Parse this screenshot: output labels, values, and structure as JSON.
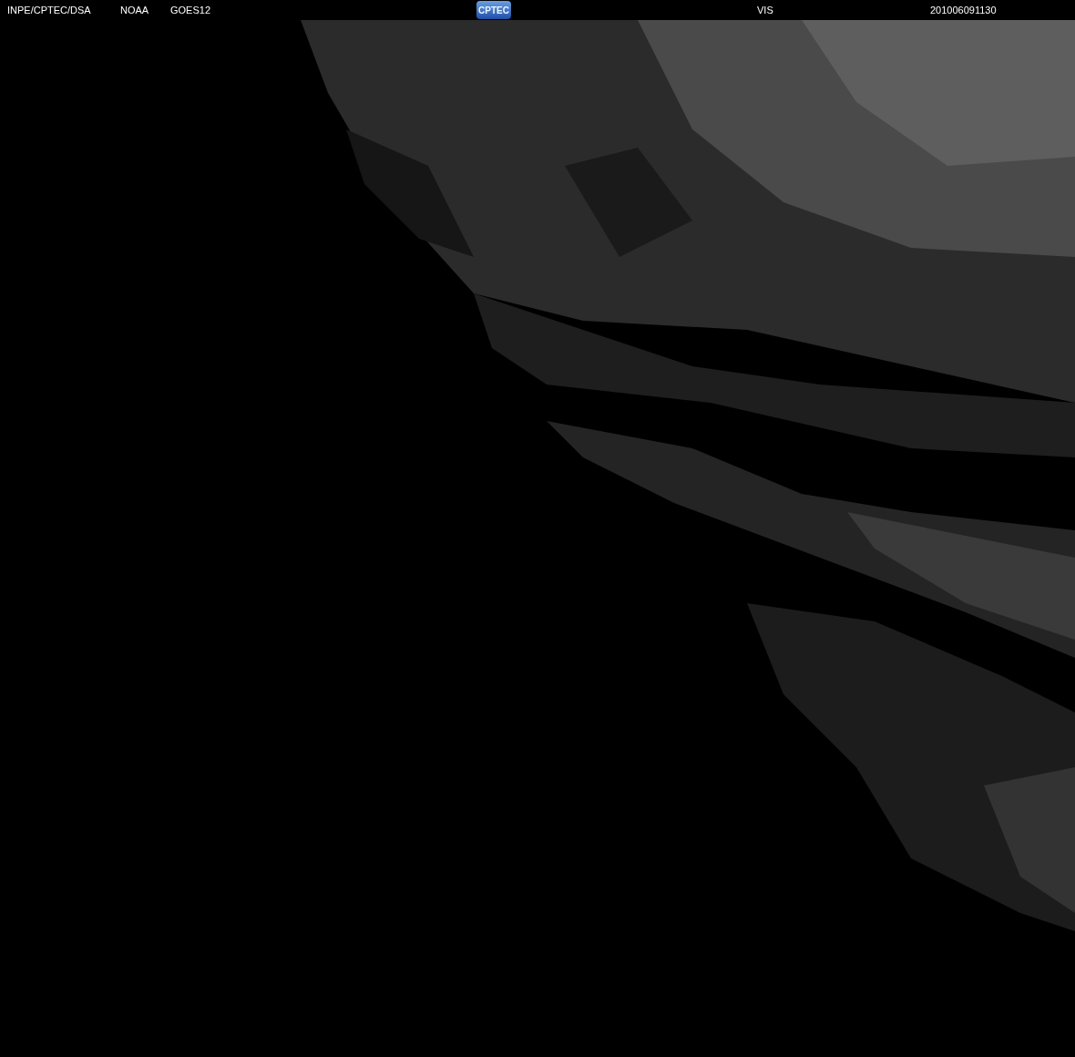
{
  "header": {
    "source": "INPE/CPTEC/DSA",
    "agency": "NOAA",
    "satellite": "GOES12",
    "logo": "CPTEC",
    "channel": "VIS",
    "timestamp": "201006091130"
  }
}
